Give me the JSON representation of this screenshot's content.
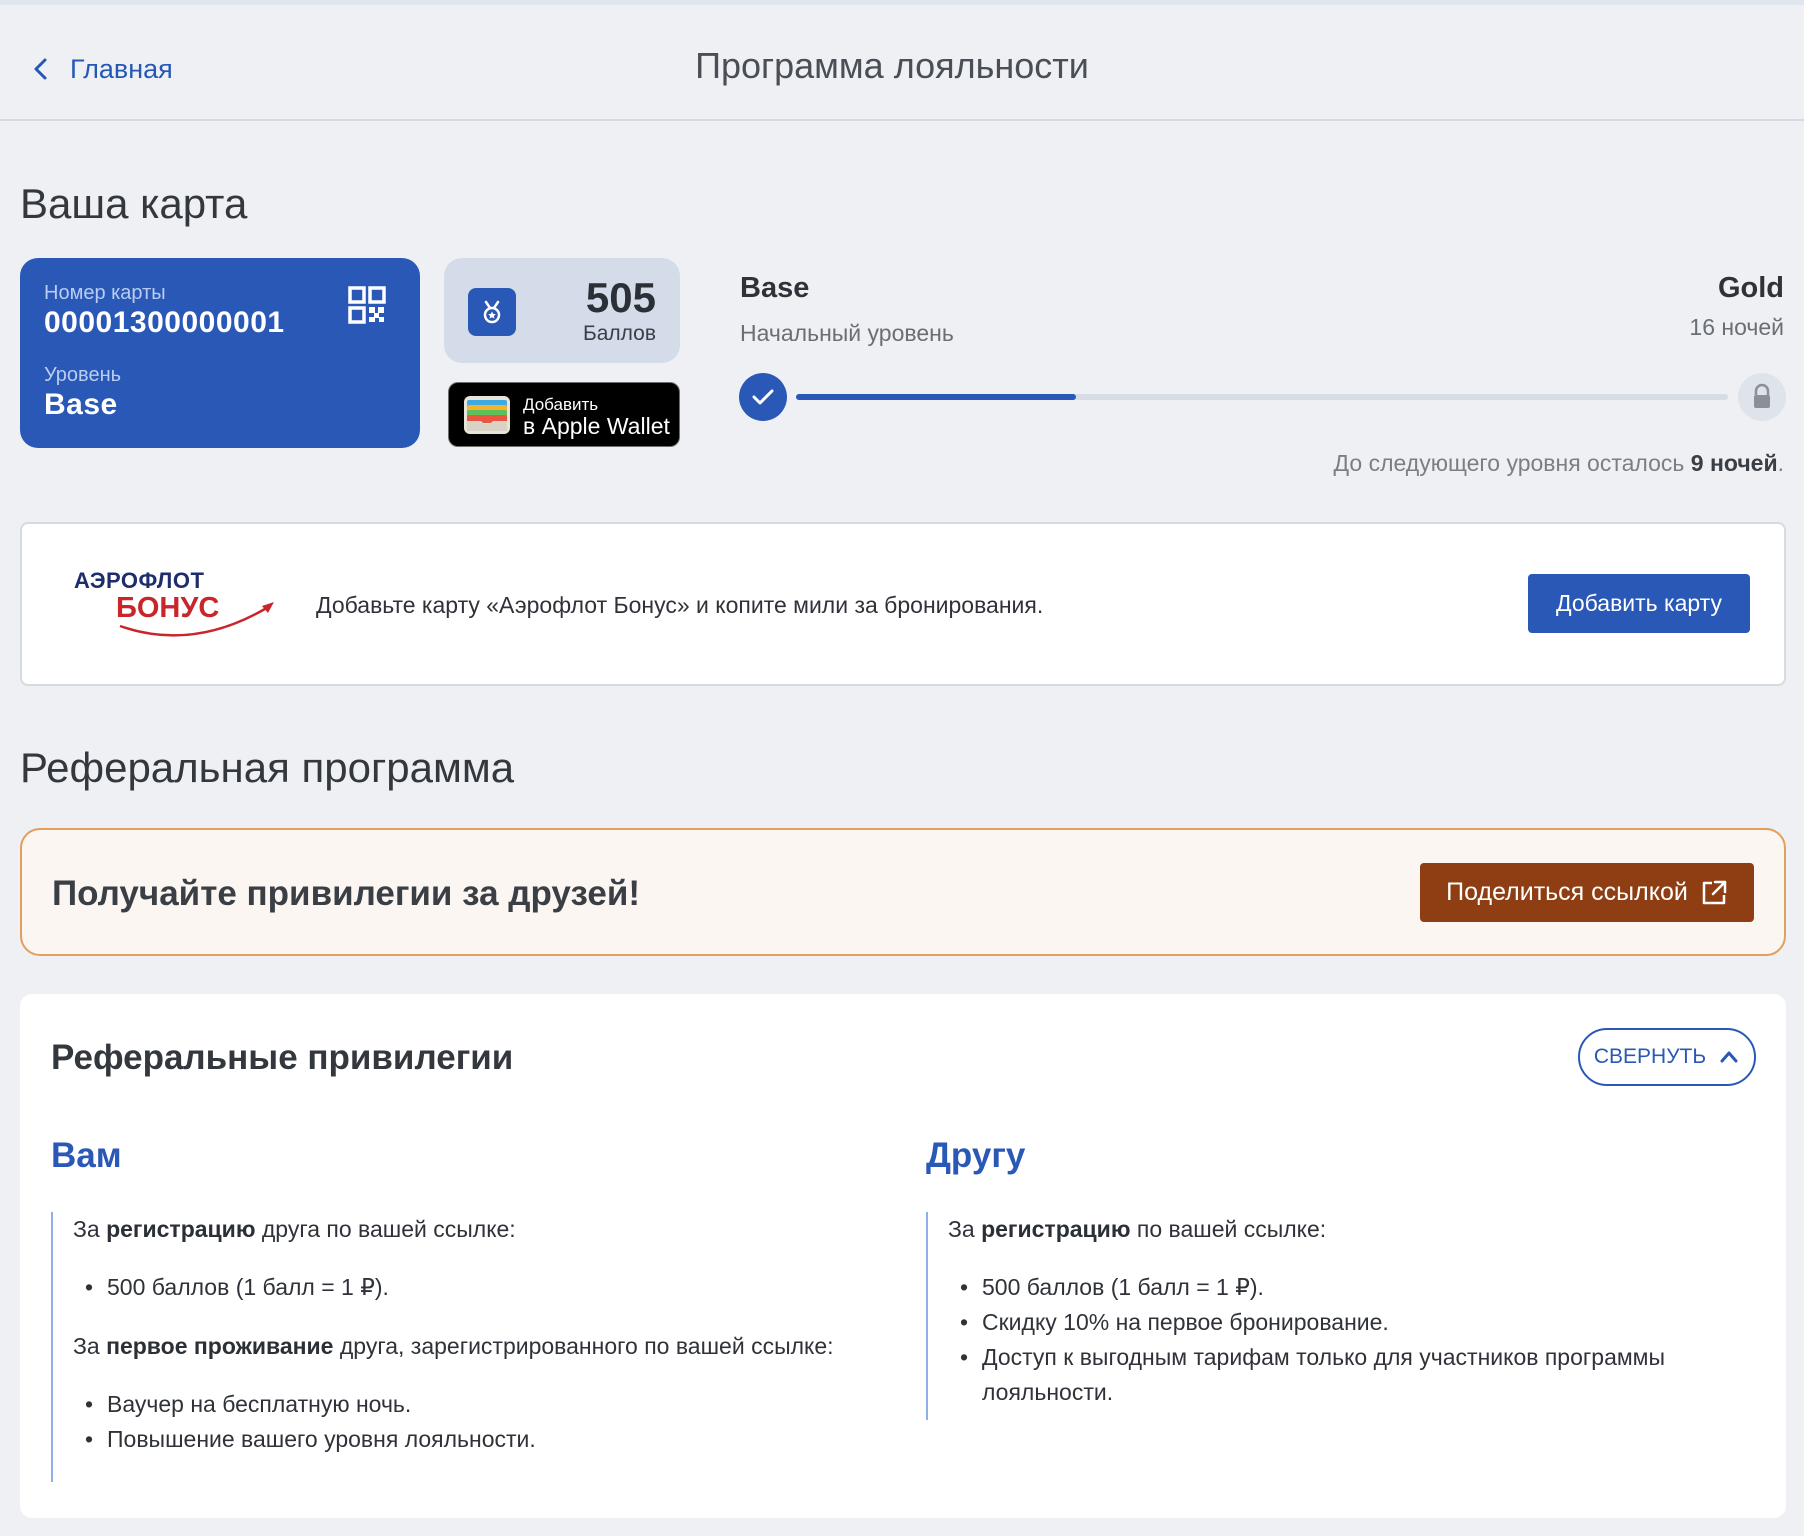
{
  "header": {
    "back_label": "Главная",
    "title": "Программа лояльности"
  },
  "card_section": {
    "title": "Ваша карта",
    "card": {
      "number_label": "Номер карты",
      "number": "00001300000001",
      "level_label": "Уровень",
      "level": "Base"
    },
    "points": {
      "value": "505",
      "label": "Баллов"
    },
    "wallet": {
      "line1": "Добавить",
      "line2": "в Apple Wallet"
    },
    "progress": {
      "current_level": "Base",
      "current_sub": "Начальный уровень",
      "next_level": "Gold",
      "next_sub": "16 ночей",
      "fraction": 0.3,
      "note_prefix": "До следующего уровня осталось ",
      "note_bold": "9 ночей",
      "note_suffix": "."
    }
  },
  "aeroflot": {
    "logo_top": "АЭРОФЛОТ",
    "logo_bottom": "БОНУС",
    "text": "Добавьте карту «Аэрофлот Бонус» и копите мили за бронирования.",
    "button": "Добавить карту"
  },
  "referral": {
    "title": "Реферальная программа",
    "banner_text": "Получайте привилегии за друзей!",
    "share_button": "Поделиться ссылкой",
    "privileges": {
      "title": "Реферальные привилегии",
      "collapse_label": "СВЕРНУТЬ",
      "you": {
        "heading": "Вам",
        "reg_pre": "За ",
        "reg_bold": "регистрацию",
        "reg_post": " друга по вашей ссылке:",
        "reg_items": [
          "500 баллов (1 балл = 1 ₽)."
        ],
        "stay_pre": "За ",
        "stay_bold": "первое проживание",
        "stay_post": " друга, зарегистрированного по вашей ссылке:",
        "stay_items": [
          "Ваучер на бесплатную ночь.",
          "Повышение вашего уровня лояльности."
        ]
      },
      "friend": {
        "heading": "Другу",
        "reg_pre": "За ",
        "reg_bold": "регистрацию",
        "reg_post": " по вашей ссылке:",
        "reg_items": [
          "500 баллов (1 балл = 1 ₽).",
          "Скидку 10% на первое бронирование.",
          "Доступ к выгодным тарифам только для участников программы лояльности."
        ]
      }
    }
  },
  "colors": {
    "primary": "#2a58b6",
    "share_button": "#8e3e12",
    "banner_border": "#e39e5e",
    "aeroflot_red": "#c8262b"
  }
}
